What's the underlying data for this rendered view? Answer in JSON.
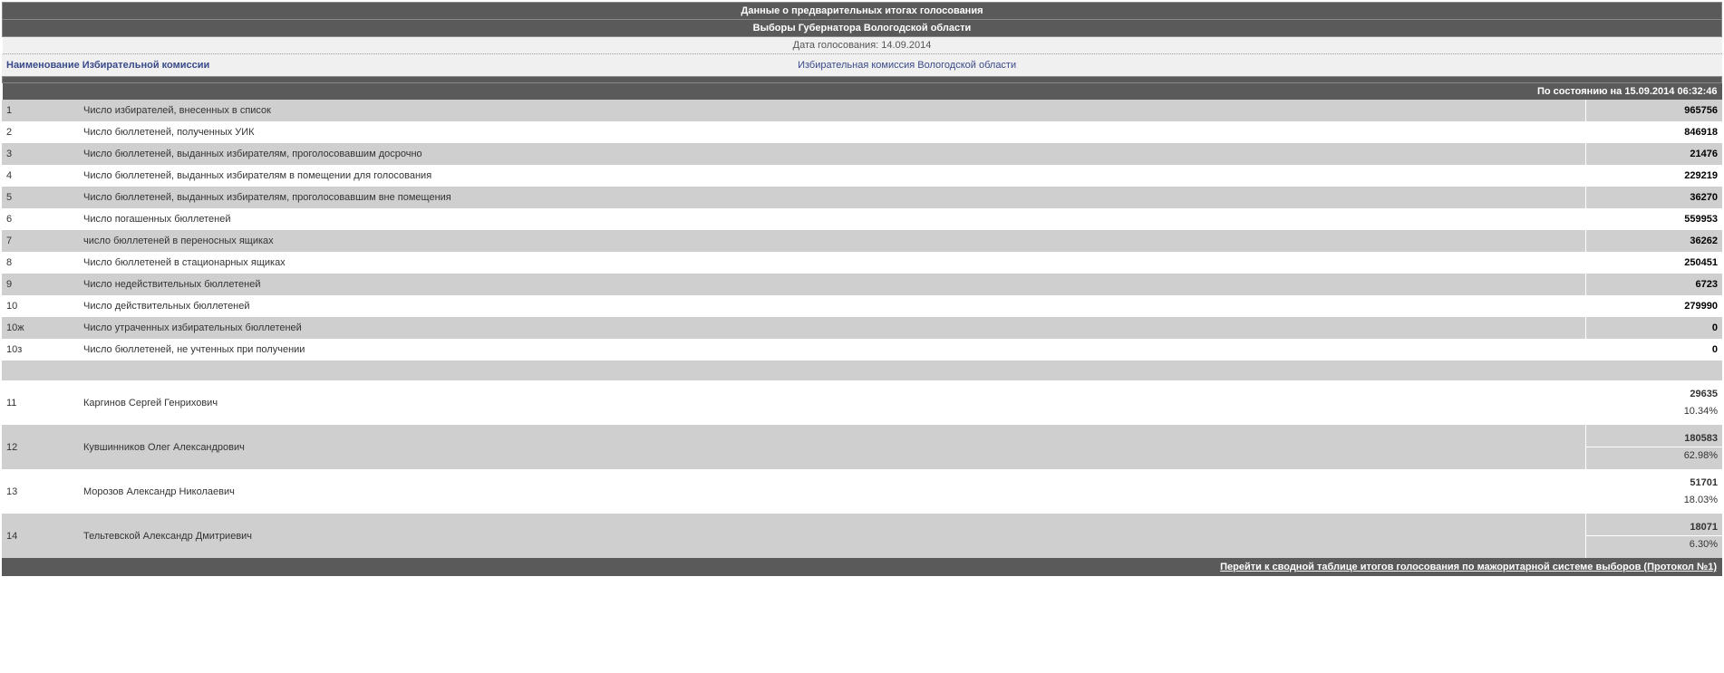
{
  "header": {
    "title1": "Данные о предварительных итогах голосования",
    "title2": "Выборы Губернатора Вологодской области",
    "date_label": "Дата голосования:  14.09.2014"
  },
  "commission": {
    "label": "Наименование Избирательной комиссии",
    "value": "Избирательная комиссия Вологодской области"
  },
  "status": "По состоянию на 15.09.2014 06:32:46",
  "rows": [
    {
      "n": "1",
      "label": "Число избирателей, внесенных в список",
      "value": "965756"
    },
    {
      "n": "2",
      "label": "Число бюллетеней, полученных УИК",
      "value": "846918"
    },
    {
      "n": "3",
      "label": "Число бюллетеней, выданных избирателям, проголосовавшим досрочно",
      "value": "21476"
    },
    {
      "n": "4",
      "label": "Число бюллетеней, выданных избирателям в помещении для голосования",
      "value": "229219"
    },
    {
      "n": "5",
      "label": "Число бюллетеней, выданных избирателям, проголосовавшим вне помещения",
      "value": "36270"
    },
    {
      "n": "6",
      "label": "Число погашенных бюллетеней",
      "value": "559953"
    },
    {
      "n": "7",
      "label": "число бюллетеней в переносных ящиках",
      "value": "36262"
    },
    {
      "n": "8",
      "label": "Число бюллетеней в стационарных ящиках",
      "value": "250451"
    },
    {
      "n": "9",
      "label": "Число недействительных бюллетеней",
      "value": "6723"
    },
    {
      "n": "10",
      "label": "Число действительных бюллетеней",
      "value": "279990"
    },
    {
      "n": "10ж",
      "label": "Число утраченных избирательных бюллетеней",
      "value": "0"
    },
    {
      "n": "10з",
      "label": "Число бюллетеней, не учтенных при получении",
      "value": "0"
    }
  ],
  "candidates": [
    {
      "n": "11",
      "name": "Каргинов Сергей Генрихович",
      "votes": "29635",
      "pct": "10.34%"
    },
    {
      "n": "12",
      "name": "Кувшинников Олег Александрович",
      "votes": "180583",
      "pct": "62.98%"
    },
    {
      "n": "13",
      "name": "Морозов Александр Николаевич",
      "votes": "51701",
      "pct": "18.03%"
    },
    {
      "n": "14",
      "name": "Тельтевской Александр Дмитриевич",
      "votes": "18071",
      "pct": "6.30%"
    }
  ],
  "footer_link": "Перейти к сводной таблице итогов голосования по мажоритарной системе выборов (Протокол №1)"
}
